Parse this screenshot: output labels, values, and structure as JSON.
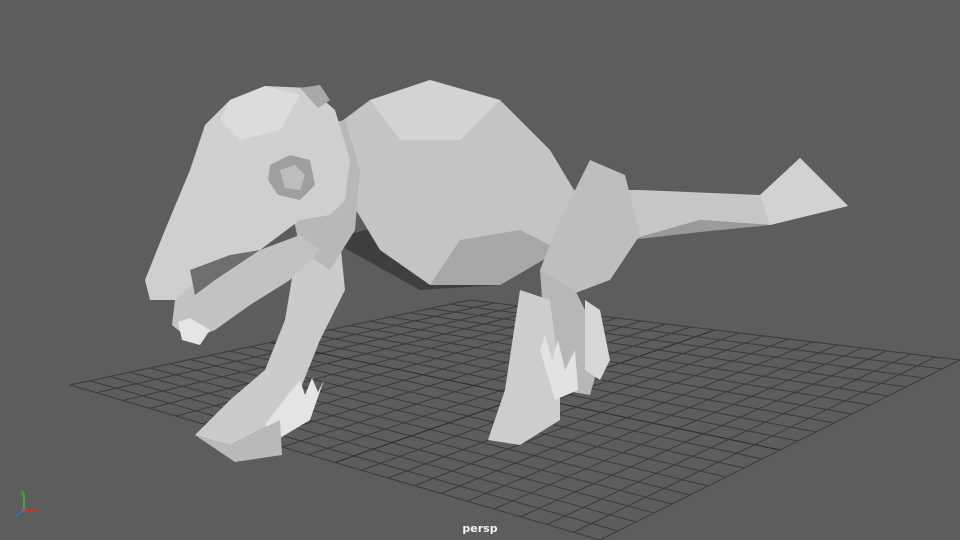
{
  "viewport": {
    "camera_label": "persp",
    "background_color": "#5d5d5d",
    "grid_color": "#3a3a3a",
    "model_color": "#c9c9c9",
    "model_shadow_color": "#7a7a7a"
  },
  "axis_gizmo": {
    "icon": "xyz-axis-icon",
    "x_color": "#d9322b",
    "y_color": "#3fbf3f",
    "z_color": "#3a6fd6"
  },
  "model": {
    "type": "low-poly quadruped creature mesh",
    "icon": "creature-mesh"
  }
}
